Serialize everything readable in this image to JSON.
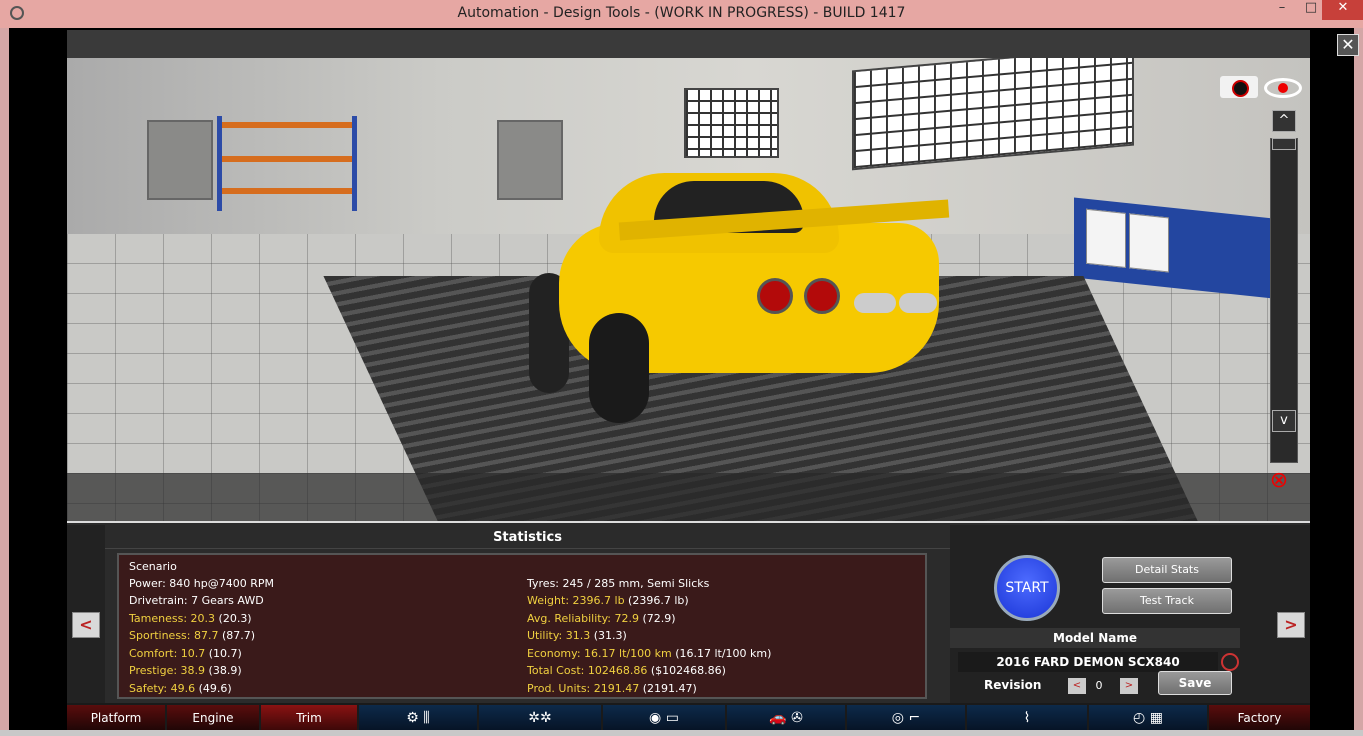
{
  "window": {
    "title": "Automation - Design Tools - (WORK IN PROGRESS) - BUILD 1417",
    "minimize": "–",
    "maximize": "□",
    "close": "✕"
  },
  "viewport": {
    "close_label": "✕",
    "scroll_up": "^",
    "scroll_down": "v"
  },
  "nav": {
    "prev": "<",
    "next": ">"
  },
  "statistics": {
    "heading": "Statistics",
    "scenario": "Scenario",
    "power": "Power: 840 hp@7400 RPM",
    "drivetrain": "Drivetrain: 7 Gears AWD",
    "tyres": "Tyres: 245 / 285 mm, Semi Slicks",
    "left": [
      {
        "label": "Tameness: 20.3",
        "extra": " (20.3)"
      },
      {
        "label": "Sportiness: 87.7",
        "extra": " (87.7)"
      },
      {
        "label": "Comfort: 10.7",
        "extra": " (10.7)"
      },
      {
        "label": "Prestige: 38.9",
        "extra": " (38.9)"
      },
      {
        "label": "Safety: 49.6",
        "extra": " (49.6)"
      }
    ],
    "right": [
      {
        "label": "Weight: 2396.7 lb",
        "extra": " (2396.7 lb)"
      },
      {
        "label": "Avg. Reliability: 72.9",
        "extra": " (72.9)"
      },
      {
        "label": "Utility: 31.3",
        "extra": " (31.3)"
      },
      {
        "label": "Economy: 16.17 lt/100 km",
        "extra": " (16.17 lt/100 km)"
      },
      {
        "label": "Total Cost: 102468.86",
        "extra": " ($102468.86)"
      },
      {
        "label": "Prod. Units: 2191.47",
        "extra": " (2191.47)"
      }
    ]
  },
  "controls": {
    "start": "START",
    "detail_stats": "Detail Stats",
    "test_track": "Test Track",
    "model_name_heading": "Model Name",
    "model_name": "2016 FARD DEMON SCX840",
    "revision_label": "Revision",
    "revision_value": "0",
    "rev_prev": "<",
    "rev_next": ">",
    "save": "Save"
  },
  "tabs": {
    "platform": "Platform",
    "engine": "Engine",
    "trim": "Trim",
    "gearbox_icons": "⚙ ⫼",
    "wheels_icons": "✲✲",
    "brakes_icons": "◉ ▭",
    "body_icons": "🚗 ✇",
    "interior_icons": "◎ ⌐",
    "suspension_icons": "⌇",
    "testing_icons": "◴ ▦",
    "factory": "Factory"
  },
  "colors": {
    "accent_red": "#5a0d0d",
    "accent_blue": "#0d2a4a",
    "stat_yellow": "#f0d040",
    "start_blue": "#1a35d6",
    "car_yellow": "#f6c900"
  },
  "icons": {
    "camera": "camera-icon",
    "eye": "eye-icon",
    "rotate_off": "rotate-off-icon",
    "refresh": "refresh-icon"
  }
}
